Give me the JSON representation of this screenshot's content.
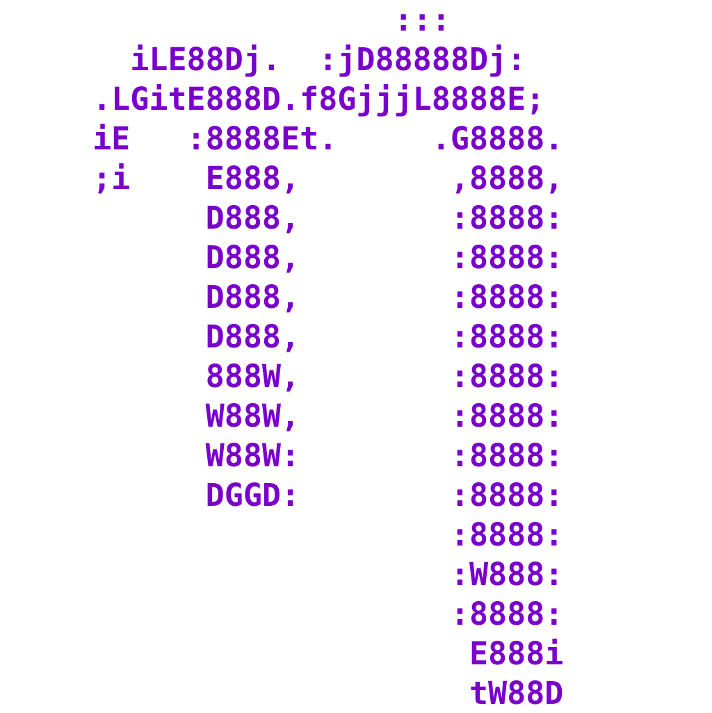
{
  "colors": {
    "text": "#7a00cc",
    "background": "#ffffff"
  },
  "art_lines": [
    "                 :::",
    "   iLE88Dj.  :jD88888Dj:",
    " .LGitE888D.f8GjjjL8888E;",
    " iE   :8888Et.     .G8888.",
    " ;i    E888,        ,8888,",
    "       D888,        :8888:",
    "       D888,        :8888:",
    "       D888,        :8888:",
    "       D888,        :8888:",
    "       888W,        :8888:",
    "       W88W,        :8888:",
    "       W88W:        :8888:",
    "       DGGD:        :8888:",
    "                    :8888:",
    "                    :W888:",
    "                    :8888:",
    "                     E888i",
    "                     tW88D"
  ]
}
